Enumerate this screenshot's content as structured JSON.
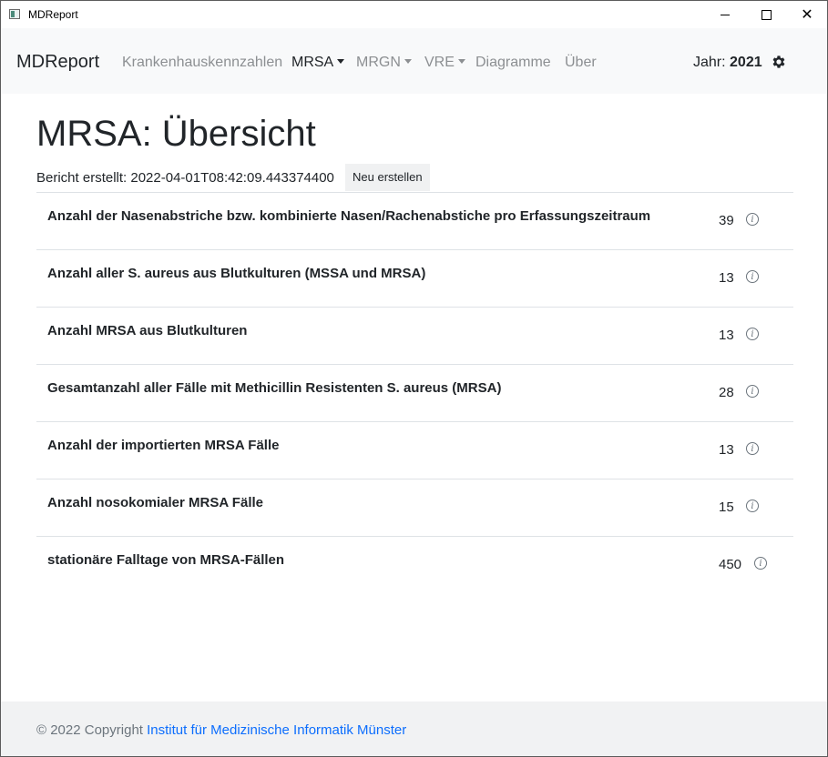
{
  "window": {
    "title": "MDReport",
    "icon": "app-window-icon",
    "controls": [
      "minimize-icon",
      "maximize-icon",
      "close-icon"
    ]
  },
  "nav": {
    "brand": "MDReport",
    "items": [
      {
        "label": "Krankenhauskennzahlen",
        "dropdown": false,
        "active": false
      },
      {
        "label": "MRSA",
        "dropdown": true,
        "active": true
      },
      {
        "label": "MRGN",
        "dropdown": true,
        "active": false
      },
      {
        "label": "VRE",
        "dropdown": true,
        "active": false
      },
      {
        "label": "Diagramme",
        "dropdown": false,
        "active": false
      },
      {
        "label": "Über",
        "dropdown": false,
        "active": false
      }
    ],
    "year_label": "Jahr:",
    "year_value": "2021",
    "settings_icon": "gear-icon"
  },
  "main": {
    "title": "MRSA: Übersicht",
    "report_created_label": "Bericht erstellt:",
    "report_created_value": "2022-04-01T08:42:09.443374400",
    "regenerate_button": "Neu erstellen",
    "rows": [
      {
        "label": "Anzahl der Nasenabstriche bzw. kombinierte Nasen/Rachenabstiche pro Erfassungszeitraum",
        "value": "39"
      },
      {
        "label": "Anzahl aller S. aureus aus Blutkulturen (MSSA und MRSA)",
        "value": "13"
      },
      {
        "label": "Anzahl MRSA aus Blutkulturen",
        "value": "13"
      },
      {
        "label": "Gesamtanzahl aller Fälle mit Methicillin Resistenten S. aureus (MRSA)",
        "value": "28"
      },
      {
        "label": "Anzahl der importierten MRSA Fälle",
        "value": "13"
      },
      {
        "label": "Anzahl nosokomialer MRSA Fälle",
        "value": "15"
      },
      {
        "label": "stationäre Falltage von MRSA-Fällen",
        "value": "450"
      }
    ]
  },
  "footer": {
    "copyright": "© 2022 Copyright",
    "link_text": "Institut für Medizinische Informatik Münster"
  },
  "colors": {
    "navbar_bg": "#f8f9fa",
    "footer_bg": "#f1f2f3",
    "link": "#0d6efd",
    "muted_nav": "#8c8f92",
    "divider": "#dee2e6"
  }
}
